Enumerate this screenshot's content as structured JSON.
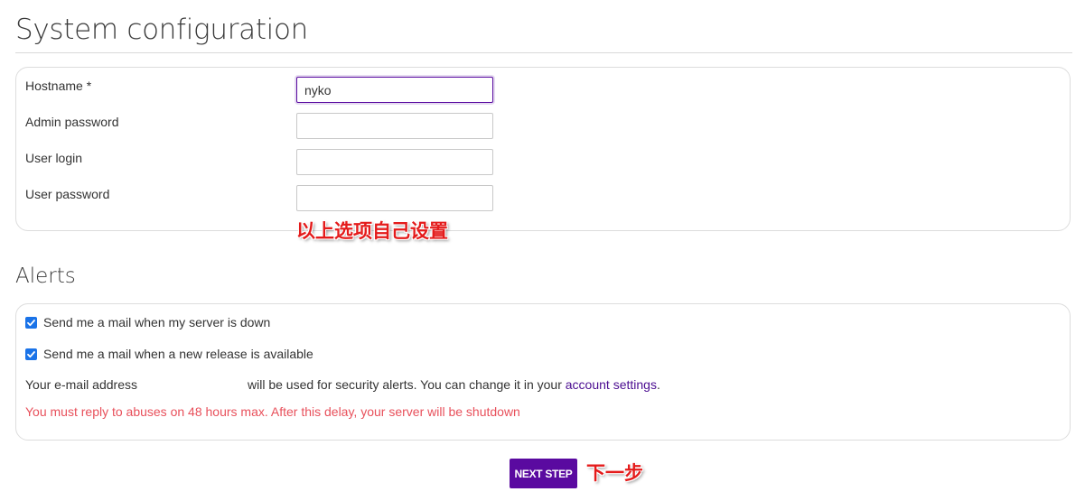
{
  "page": {
    "title": "System configuration"
  },
  "config": {
    "fields": [
      {
        "label": "Hostname *",
        "value": "nyko",
        "placeholder": "",
        "focused": true
      },
      {
        "label": "Admin password",
        "value": "",
        "placeholder": ""
      },
      {
        "label": "User login",
        "value": "",
        "placeholder": ""
      },
      {
        "label": "User password",
        "value": "",
        "placeholder": ""
      }
    ],
    "annotation": "以上选项自己设置"
  },
  "alerts": {
    "title": "Alerts",
    "options": [
      {
        "label": "Send me a mail when my server is down",
        "checked": true
      },
      {
        "label": "Send me a mail when a new release is available",
        "checked": true
      }
    ],
    "email_prefix": "Your e-mail address",
    "email_suffix": "will be used for security alerts. You can change it in your",
    "account_link": "account settings",
    "email_end": ".",
    "warning": "You must reply to abuses on 48 hours max. After this delay, your server will be shutdown"
  },
  "footer": {
    "next_button": "NEXT STEP",
    "annotation": "下一步"
  },
  "colors": {
    "accent": "#5a0aa0",
    "link": "#4b0d91",
    "warning": "#e8505b",
    "checkbox": "#1a73e8",
    "annotation": "#e41b1b"
  },
  "icons": {
    "checkbox": "checkmark-icon"
  }
}
